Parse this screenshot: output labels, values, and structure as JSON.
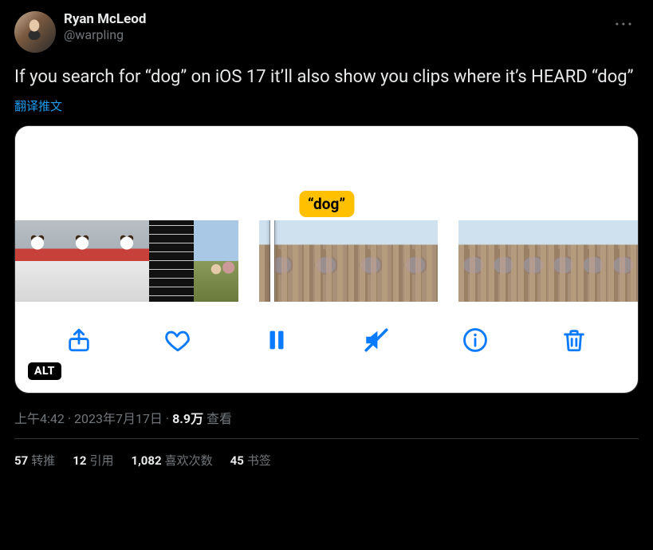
{
  "author": {
    "display_name": "Ryan McLeod",
    "handle": "@warpling"
  },
  "tweet_text": "If you search for “dog” on iOS 17 it’ll also show you clips where it’s HEARD “dog”",
  "translate_label": "翻译推文",
  "media": {
    "badge_text": "“dog”",
    "alt_label": "ALT",
    "controls": {
      "share": "share",
      "like": "like",
      "pause": "pause",
      "mute": "mute",
      "info": "info",
      "delete": "delete"
    }
  },
  "meta": {
    "time": "上午4:42",
    "sep1": " · ",
    "date": "2023年7月17日",
    "sep2": " · ",
    "views_count": "8.9万",
    "views_label": " 查看"
  },
  "stats": {
    "retweets_count": "57",
    "retweets_label": "转推",
    "quotes_count": "12",
    "quotes_label": "引用",
    "likes_count": "1,082",
    "likes_label": "喜欢次数",
    "bookmarks_count": "45",
    "bookmarks_label": "书签"
  }
}
